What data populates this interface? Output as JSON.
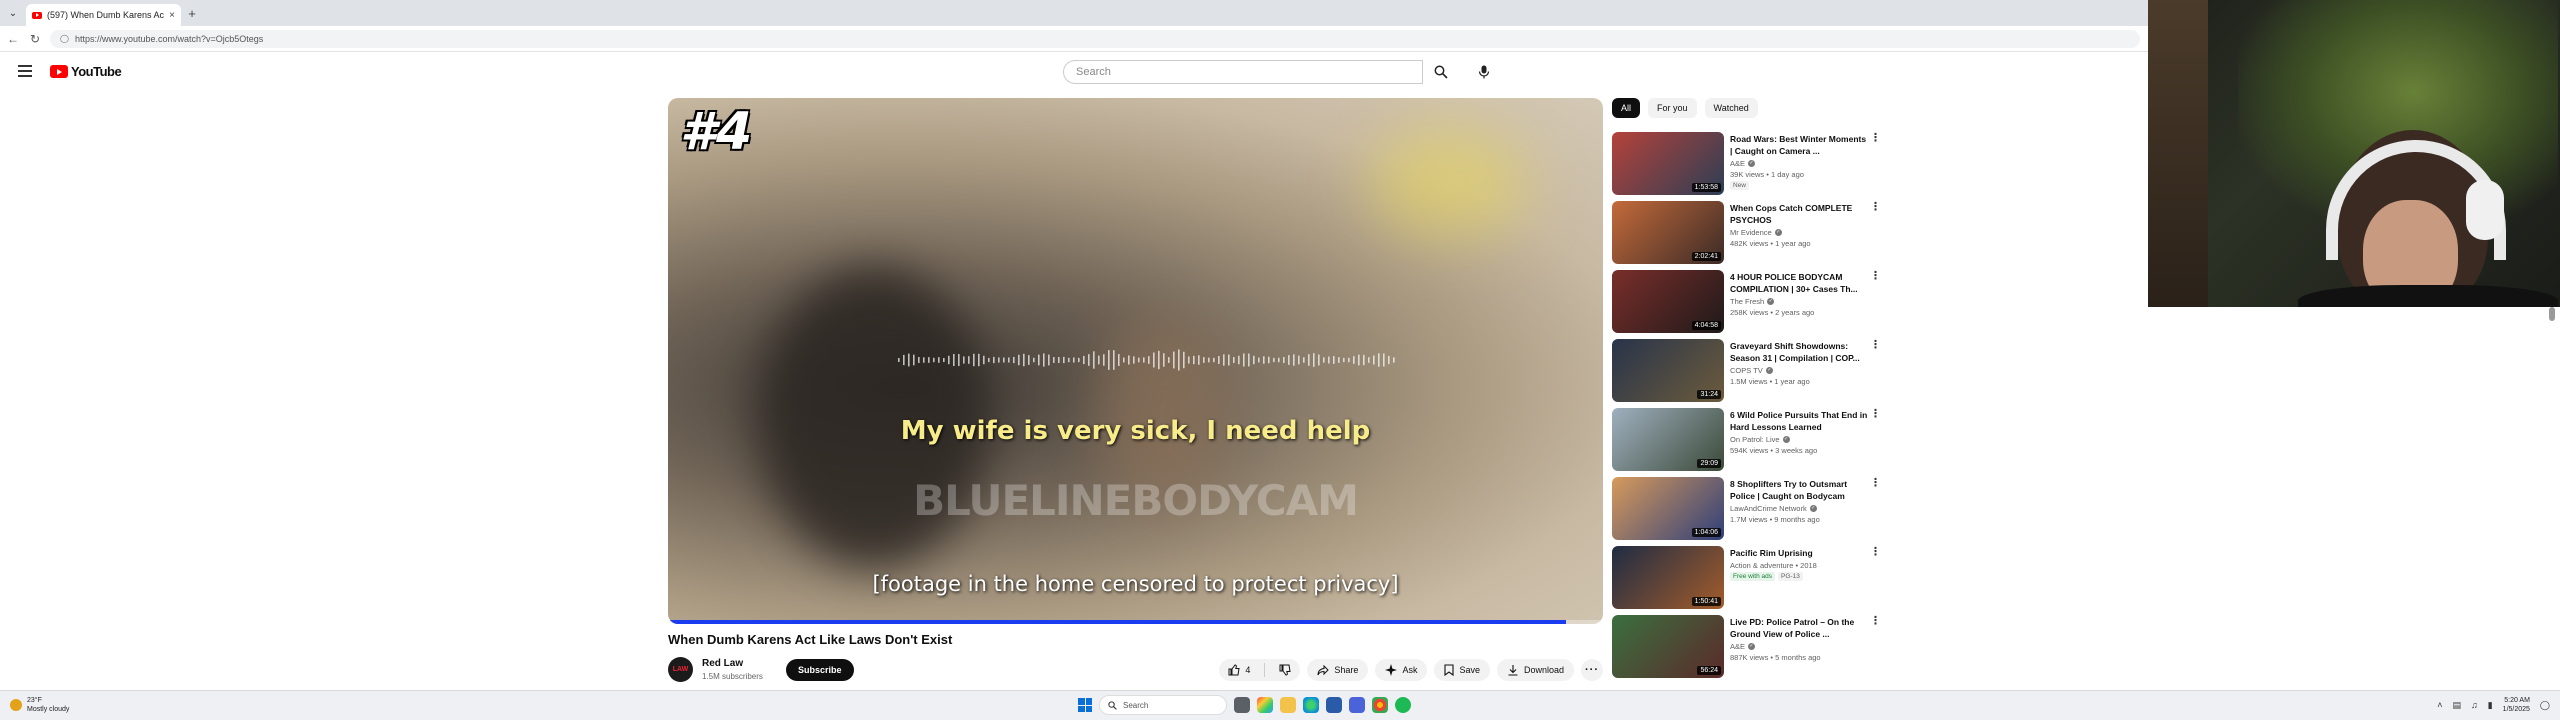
{
  "browser": {
    "tab_title": "(597) When Dumb Karens Ac",
    "url": "https://www.youtube.com/watch?v=Ojcb5Otegs"
  },
  "youtube": {
    "logo_text": "YouTube",
    "search_placeholder": "Search"
  },
  "player": {
    "rank_overlay": "#4",
    "caption_main": "My wife is very sick, I need help",
    "watermark": "BLUELINEBODYCAM",
    "caption_bottom": "[footage in the home censored to protect privacy]",
    "progress_fraction": 0.96,
    "progress_color": "#1a3cf0"
  },
  "video": {
    "title": "When Dumb Karens Act Like Laws Don't Exist",
    "channel_name": "Red Law",
    "channel_avatar_text": "LAW",
    "subscribers": "1.5M subscribers",
    "subscribe_label": "Subscribe",
    "like_count": "4",
    "share_label": "Share",
    "ask_label": "Ask",
    "save_label": "Save",
    "download_label": "Download"
  },
  "chips": [
    "All",
    "For you",
    "Watched"
  ],
  "recommendations": [
    {
      "title": "Road Wars: Best Winter Moments | Caught on Camera ...",
      "channel": "A&E",
      "verified": true,
      "meta": "39K views • 1 day ago",
      "badge": "New",
      "duration": "1:53:58",
      "thumb_colors": [
        "#b5423a",
        "#2c3e55"
      ]
    },
    {
      "title": "When Cops Catch COMPLETE PSYCHOS",
      "channel": "Mr Evidence",
      "verified": true,
      "meta": "482K views • 1 year ago",
      "badge": "",
      "duration": "2:02:41",
      "thumb_colors": [
        "#c46a3a",
        "#3b2b27"
      ]
    },
    {
      "title": "4 HOUR POLICE BODYCAM COMPILATION | 30+ Cases Th...",
      "channel": "The Fresh",
      "verified": true,
      "meta": "258K views • 2 years ago",
      "badge": "",
      "duration": "4:04:58",
      "thumb_colors": [
        "#7a2e2a",
        "#1e1a1a"
      ]
    },
    {
      "title": "Graveyard Shift Showdowns: Season 31 | Compilation | COP...",
      "channel": "COPS TV",
      "verified": true,
      "meta": "1.5M views • 1 year ago",
      "badge": "",
      "duration": "31:24",
      "thumb_colors": [
        "#28344a",
        "#6c5b3c"
      ]
    },
    {
      "title": "6 Wild Police Pursuits That End in Hard Lessons Learned",
      "channel": "On Patrol: Live",
      "verified": true,
      "meta": "594K views • 3 weeks ago",
      "badge": "",
      "duration": "29:09",
      "thumb_colors": [
        "#9fb0bf",
        "#3c4a39"
      ]
    },
    {
      "title": "8 Shoplifters Try to Outsmart Police | Caught on Bodycam",
      "channel": "LawAndCrime Network",
      "verified": true,
      "meta": "1.7M views • 9 months ago",
      "badge": "",
      "duration": "1:04:06",
      "thumb_colors": [
        "#d79a5c",
        "#2f3f7a"
      ]
    },
    {
      "title": "Pacific Rim Uprising",
      "channel": "Action & adventure • 2018",
      "verified": false,
      "meta": "",
      "badge": "Free with ads",
      "badge2": "PG-13",
      "duration": "1:50:41",
      "thumb_colors": [
        "#1f2c44",
        "#a35c2b"
      ]
    },
    {
      "title": "Live PD: Police Patrol – On the Ground View of Police ...",
      "channel": "A&E",
      "verified": true,
      "meta": "887K views • 5 months ago",
      "badge": "",
      "duration": "56:24",
      "thumb_colors": [
        "#3b6f3f",
        "#5b2a2a"
      ]
    }
  ],
  "taskbar": {
    "weather_temp": "23°F",
    "weather_desc": "Mostly cloudy",
    "search_label": "Search",
    "time": "5:20 AM",
    "date": "1/5/2025"
  }
}
